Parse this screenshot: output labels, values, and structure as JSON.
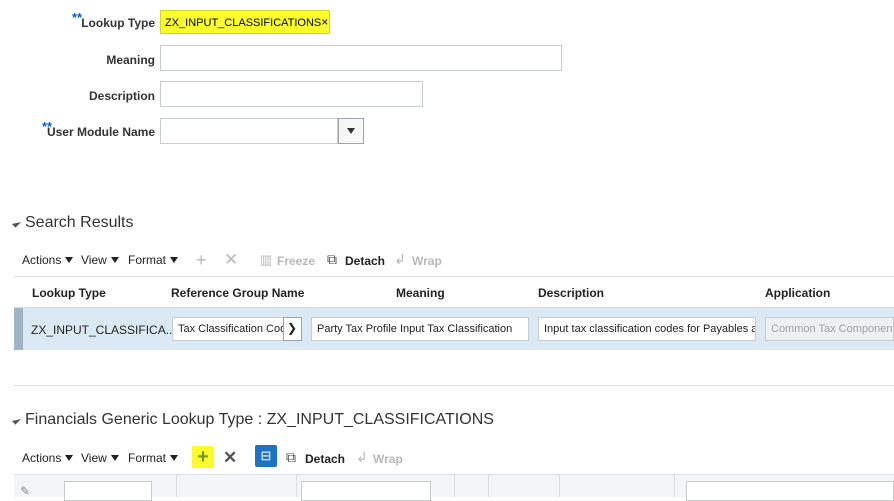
{
  "form": {
    "lookup_type": {
      "label": "Lookup Type",
      "value": "ZX_INPUT_CLASSIFICATIONS",
      "clear": "×",
      "required": "**"
    },
    "meaning": {
      "label": "Meaning",
      "value": ""
    },
    "description": {
      "label": "Description",
      "value": ""
    },
    "user_module": {
      "label": "User Module Name",
      "value": "",
      "required": "**"
    }
  },
  "search_results": {
    "title": "Search Results",
    "toolbar": {
      "actions": "Actions",
      "view": "View",
      "format": "Format",
      "freeze": "Freeze",
      "detach": "Detach",
      "wrap": "Wrap"
    },
    "columns": [
      "Lookup Type",
      "Reference Group Name",
      "Meaning",
      "Description",
      "Application"
    ],
    "row": {
      "lookup_type": "ZX_INPUT_CLASSIFICA...",
      "reference_group": "Tax Classification Code",
      "meaning": "Party Tax Profile Input Tax Classification",
      "description": "Input tax classification codes for Payables an",
      "application": "Common Tax Components"
    }
  },
  "generic_lookup": {
    "title": "Financials Generic Lookup Type : ZX_INPUT_CLASSIFICATIONS",
    "toolbar": {
      "actions": "Actions",
      "view": "View",
      "format": "Format",
      "detach": "Detach",
      "wrap": "Wrap"
    }
  },
  "colors": {
    "highlight": "#fcfc2c",
    "required": "#0c62c9",
    "selected_row": "#dbe9f5",
    "blue_button": "#1f73c6"
  }
}
